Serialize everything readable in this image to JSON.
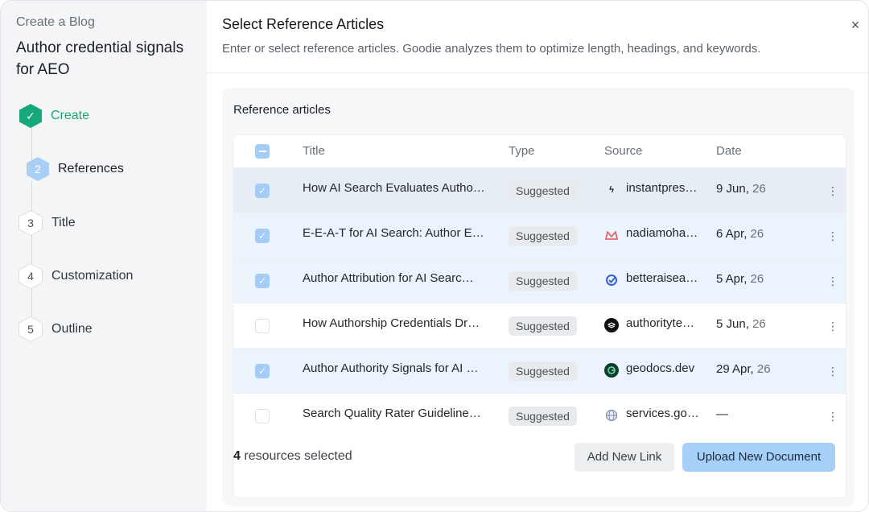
{
  "sidebar": {
    "subtitle": "Create a Blog",
    "title": "Author credential signals for AEO",
    "steps": [
      {
        "number": "✓",
        "label": "Create",
        "state": "done"
      },
      {
        "number": "2",
        "label": "References",
        "state": "active"
      },
      {
        "number": "3",
        "label": "Title",
        "state": "pending"
      },
      {
        "number": "4",
        "label": "Customization",
        "state": "pending"
      },
      {
        "number": "5",
        "label": "Outline",
        "state": "pending"
      }
    ]
  },
  "header": {
    "title": "Select Reference Articles",
    "description": "Enter or select reference articles. Goodie analyzes them to optimize length, headings, and keywords.",
    "close_icon": "×"
  },
  "panel": {
    "title": "Reference articles",
    "columns": {
      "title": "Title",
      "type": "Type",
      "source": "Source",
      "date": "Date"
    },
    "rows": [
      {
        "selected": true,
        "title": "How AI Search Evaluates Autho…",
        "type": "Suggested",
        "source": "instantpres…",
        "source_icon": "lightning-icon",
        "date_day": "9 Jun,",
        "date_year": "26"
      },
      {
        "selected": true,
        "title": "E-E-A-T for AI Search: Author E…",
        "type": "Suggested",
        "source": "nadiamoha…",
        "source_icon": "crown-icon",
        "date_day": "6 Apr,",
        "date_year": "26"
      },
      {
        "selected": true,
        "title": "Author Attribution for AI Searc…",
        "type": "Suggested",
        "source": "betteraisea…",
        "source_icon": "check-circle-icon",
        "date_day": "5 Apr,",
        "date_year": "26"
      },
      {
        "selected": false,
        "title": "How Authorship Credentials Dr…",
        "type": "Suggested",
        "source": "authorityte…",
        "source_icon": "layers-icon",
        "date_day": "5 Jun,",
        "date_year": "26"
      },
      {
        "selected": true,
        "title": "Author Authority Signals for AI …",
        "type": "Suggested",
        "source": "geodocs.dev",
        "source_icon": "globe-icon",
        "date_day": "29 Apr,",
        "date_year": "26"
      },
      {
        "selected": false,
        "title": "Search Quality Rater Guideline…",
        "type": "Suggested",
        "source": "services.go…",
        "source_icon": "globe-outline-icon",
        "date_day": "—",
        "date_year": ""
      }
    ],
    "footer": {
      "count": "4",
      "count_suffix": "resources selected",
      "add_link": "Add New Link",
      "upload": "Upload New Document"
    }
  },
  "colors": {
    "accent_green": "#16a87a",
    "accent_blue": "#a6d0f7",
    "selected_row": "#ebf3fc"
  }
}
